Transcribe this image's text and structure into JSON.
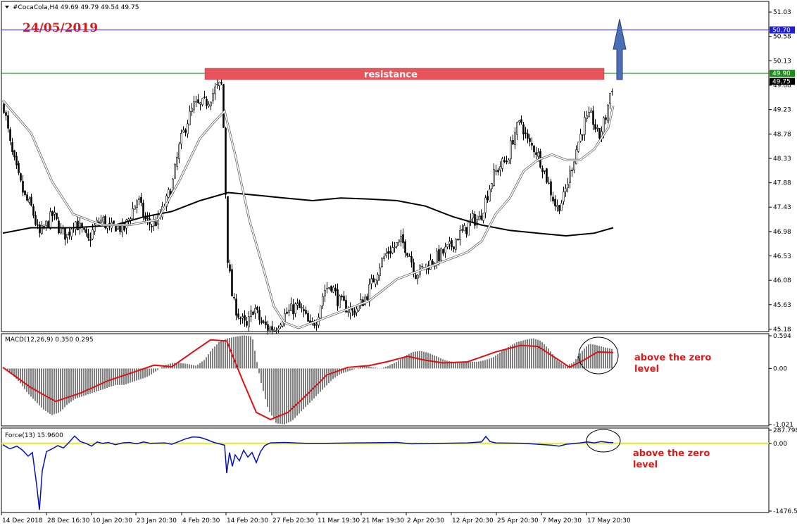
{
  "header": {
    "symbol_info": "#CocaCola,H4  49.69 49.79 49.54 49.75",
    "date_annotation": "24/05/2019",
    "resistance_label": "resistance"
  },
  "colors": {
    "candle": "#000000",
    "sma_fast": "#ffffff",
    "sma_slow": "#000000",
    "resistance_fill": "#e8545a",
    "blue_level": "#2020d0",
    "green_level": "#1a8c1a",
    "macd_signal": "#e01010",
    "force_line": "#0010c8",
    "force_zero": "#e8e820",
    "annotation": "#e01818",
    "arrow": "#4a6fb5"
  },
  "chart_data": [
    {
      "type": "candlestick",
      "title": "#CocaCola,H4",
      "ohlc_last": {
        "open": 49.69,
        "high": 49.79,
        "low": 49.54,
        "close": 49.75
      },
      "y_ticks": [
        51.03,
        50.58,
        50.13,
        49.68,
        49.23,
        48.78,
        48.33,
        47.88,
        47.43,
        46.98,
        46.53,
        46.08,
        45.63,
        45.18
      ],
      "ylim": [
        45.16,
        51.2
      ],
      "price_labels": [
        {
          "label": "50.70",
          "value": 50.7,
          "color": "#2020d0"
        },
        {
          "label": "49.90",
          "value": 49.9,
          "color": "#1a8c1a"
        },
        {
          "label": "49.75",
          "value": 49.75,
          "color": "#000000"
        }
      ],
      "x_ticks": [
        "14 Dec 2018",
        "28 Dec 16:30",
        "10 Jan 20:30",
        "23 Jan 20:30",
        "4 Feb 20:30",
        "14 Feb 20:30",
        "27 Feb 20:30",
        "11 Mar 19:30",
        "21 Mar 19:30",
        "2 Apr 20:30",
        "12 Apr 20:30",
        "25 Apr 20:30",
        "7 May 20:30",
        "17 May 20:30"
      ],
      "close_path": [
        [
          0,
          49.3
        ],
        [
          10,
          48.5
        ],
        [
          20,
          48.0
        ],
        [
          30,
          47.6
        ],
        [
          40,
          47.4
        ],
        [
          50,
          46.9
        ],
        [
          60,
          47.1
        ],
        [
          70,
          47.3
        ],
        [
          80,
          47.0
        ],
        [
          90,
          46.9
        ],
        [
          100,
          47.2
        ],
        [
          110,
          47.0
        ],
        [
          120,
          46.8
        ],
        [
          130,
          47.1
        ],
        [
          140,
          47.2
        ],
        [
          150,
          47.0
        ],
        [
          160,
          47.1
        ],
        [
          170,
          47.0
        ],
        [
          180,
          47.3
        ],
        [
          190,
          47.6
        ],
        [
          200,
          47.2
        ],
        [
          210,
          47.1
        ],
        [
          220,
          47.2
        ],
        [
          230,
          47.5
        ],
        [
          240,
          47.9
        ],
        [
          250,
          48.6
        ],
        [
          260,
          49.0
        ],
        [
          270,
          49.3
        ],
        [
          280,
          49.3
        ],
        [
          290,
          49.4
        ],
        [
          300,
          49.6
        ],
        [
          310,
          49.7
        ],
        [
          318,
          46.5
        ],
        [
          325,
          45.7
        ],
        [
          335,
          45.4
        ],
        [
          345,
          45.2
        ],
        [
          355,
          45.6
        ],
        [
          365,
          45.3
        ],
        [
          375,
          45.2
        ],
        [
          385,
          45.2
        ],
        [
          395,
          45.4
        ],
        [
          405,
          45.5
        ],
        [
          415,
          45.6
        ],
        [
          425,
          45.5
        ],
        [
          435,
          45.2
        ],
        [
          445,
          45.4
        ],
        [
          455,
          45.9
        ],
        [
          465,
          46.0
        ],
        [
          475,
          45.7
        ],
        [
          485,
          45.6
        ],
        [
          495,
          45.5
        ],
        [
          505,
          45.6
        ],
        [
          515,
          45.8
        ],
        [
          525,
          46.1
        ],
        [
          535,
          46.4
        ],
        [
          545,
          46.6
        ],
        [
          555,
          46.7
        ],
        [
          565,
          46.8
        ],
        [
          575,
          46.6
        ],
        [
          585,
          46.2
        ],
        [
          595,
          46.3
        ],
        [
          605,
          46.4
        ],
        [
          615,
          46.5
        ],
        [
          625,
          46.6
        ],
        [
          635,
          46.7
        ],
        [
          645,
          46.9
        ],
        [
          655,
          47.0
        ],
        [
          665,
          47.2
        ],
        [
          675,
          47.2
        ],
        [
          685,
          47.6
        ],
        [
          695,
          48.0
        ],
        [
          705,
          48.2
        ],
        [
          715,
          48.3
        ],
        [
          725,
          48.8
        ],
        [
          735,
          49.0
        ],
        [
          745,
          48.6
        ],
        [
          755,
          48.5
        ],
        [
          765,
          48.2
        ],
        [
          775,
          47.8
        ],
        [
          785,
          47.4
        ],
        [
          795,
          47.6
        ],
        [
          805,
          48.1
        ],
        [
          815,
          48.6
        ],
        [
          825,
          49.0
        ],
        [
          835,
          49.1
        ],
        [
          845,
          48.7
        ],
        [
          855,
          49.1
        ],
        [
          862,
          49.6
        ],
        [
          867,
          49.75
        ]
      ],
      "sma_fast_path": [
        [
          0,
          49.4
        ],
        [
          40,
          48.8
        ],
        [
          70,
          47.9
        ],
        [
          100,
          47.3
        ],
        [
          140,
          47.1
        ],
        [
          180,
          47.1
        ],
        [
          220,
          47.2
        ],
        [
          250,
          47.9
        ],
        [
          280,
          48.7
        ],
        [
          300,
          49.0
        ],
        [
          315,
          49.2
        ],
        [
          330,
          48.4
        ],
        [
          350,
          47.2
        ],
        [
          370,
          46.3
        ],
        [
          385,
          45.6
        ],
        [
          400,
          45.3
        ],
        [
          420,
          45.2
        ],
        [
          440,
          45.3
        ],
        [
          460,
          45.4
        ],
        [
          480,
          45.5
        ],
        [
          500,
          45.6
        ],
        [
          520,
          45.7
        ],
        [
          540,
          45.9
        ],
        [
          560,
          46.1
        ],
        [
          580,
          46.2
        ],
        [
          600,
          46.3
        ],
        [
          620,
          46.4
        ],
        [
          640,
          46.5
        ],
        [
          660,
          46.6
        ],
        [
          680,
          46.8
        ],
        [
          700,
          47.3
        ],
        [
          720,
          47.6
        ],
        [
          740,
          48.1
        ],
        [
          760,
          48.3
        ],
        [
          780,
          48.4
        ],
        [
          800,
          48.3
        ],
        [
          820,
          48.3
        ],
        [
          840,
          48.5
        ],
        [
          860,
          48.9
        ],
        [
          867,
          49.3
        ]
      ],
      "sma_slow_path": [
        [
          0,
          46.95
        ],
        [
          40,
          47.05
        ],
        [
          100,
          47.05
        ],
        [
          160,
          47.1
        ],
        [
          200,
          47.25
        ],
        [
          240,
          47.35
        ],
        [
          280,
          47.55
        ],
        [
          320,
          47.7
        ],
        [
          360,
          47.65
        ],
        [
          400,
          47.6
        ],
        [
          440,
          47.55
        ],
        [
          480,
          47.6
        ],
        [
          520,
          47.58
        ],
        [
          560,
          47.55
        ],
        [
          600,
          47.45
        ],
        [
          640,
          47.25
        ],
        [
          680,
          47.1
        ],
        [
          720,
          47.0
        ],
        [
          760,
          46.95
        ],
        [
          800,
          46.9
        ],
        [
          840,
          46.95
        ],
        [
          867,
          47.05
        ]
      ]
    },
    {
      "type": "bar",
      "title": "MACD(12,26,9) 0.350 0.295",
      "y_ticks": [
        0.594,
        0.0,
        -1.021
      ],
      "ylim": [
        -1.021,
        0.594
      ],
      "histogram": [
        0.02,
        -0.1,
        -0.25,
        -0.45,
        -0.6,
        -0.75,
        -0.85,
        -0.8,
        -0.65,
        -0.55,
        -0.5,
        -0.45,
        -0.4,
        -0.35,
        -0.3,
        -0.3,
        -0.25,
        -0.2,
        -0.15,
        -0.05,
        0.05,
        0.1,
        0.1,
        0.08,
        0.05,
        0.15,
        0.35,
        0.5,
        0.55,
        0.58,
        0.6,
        0.58,
        -0.2,
        -0.75,
        -1.0,
        -1.02,
        -0.95,
        -0.8,
        -0.65,
        -0.5,
        -0.35,
        -0.2,
        -0.1,
        -0.05,
        0.0,
        0.05,
        0.02,
        0.0,
        0.05,
        0.12,
        0.22,
        0.3,
        0.32,
        0.28,
        0.22,
        0.15,
        0.12,
        0.12,
        0.12,
        0.12,
        0.15,
        0.2,
        0.3,
        0.4,
        0.48,
        0.52,
        0.55,
        0.5,
        0.35,
        0.15,
        0.05,
        0.1,
        0.3,
        0.45,
        0.42,
        0.38,
        0.35
      ],
      "signal_path": [
        [
          0,
          0.02
        ],
        [
          40,
          -0.35
        ],
        [
          75,
          -0.6
        ],
        [
          110,
          -0.45
        ],
        [
          150,
          -0.22
        ],
        [
          190,
          -0.05
        ],
        [
          215,
          0.06
        ],
        [
          240,
          0.03
        ],
        [
          270,
          0.3
        ],
        [
          295,
          0.52
        ],
        [
          318,
          0.5
        ],
        [
          340,
          -0.2
        ],
        [
          360,
          -0.8
        ],
        [
          380,
          -0.93
        ],
        [
          405,
          -0.8
        ],
        [
          430,
          -0.5
        ],
        [
          460,
          -0.12
        ],
        [
          490,
          0.02
        ],
        [
          520,
          0.05
        ],
        [
          545,
          0.12
        ],
        [
          575,
          0.22
        ],
        [
          600,
          0.15
        ],
        [
          625,
          0.1
        ],
        [
          660,
          0.12
        ],
        [
          700,
          0.3
        ],
        [
          735,
          0.42
        ],
        [
          760,
          0.4
        ],
        [
          790,
          0.15
        ],
        [
          805,
          0.02
        ],
        [
          825,
          0.15
        ],
        [
          845,
          0.3
        ],
        [
          867,
          0.29
        ]
      ]
    },
    {
      "type": "line",
      "title": "Force(13) 15.9600",
      "y_ticks": [
        287.7989,
        0.0,
        -1476.51
      ],
      "ylim": [
        -1476.51,
        287.7989
      ],
      "force_path": [
        [
          0,
          -30
        ],
        [
          10,
          -120
        ],
        [
          20,
          -60
        ],
        [
          28,
          -150
        ],
        [
          36,
          -280
        ],
        [
          42,
          -200
        ],
        [
          48,
          -900
        ],
        [
          52,
          -1450
        ],
        [
          56,
          -600
        ],
        [
          62,
          -180
        ],
        [
          70,
          -120
        ],
        [
          78,
          -50
        ],
        [
          86,
          -100
        ],
        [
          94,
          20
        ],
        [
          102,
          160
        ],
        [
          110,
          40
        ],
        [
          118,
          0
        ],
        [
          126,
          -60
        ],
        [
          134,
          30
        ],
        [
          142,
          0
        ],
        [
          150,
          20
        ],
        [
          160,
          -30
        ],
        [
          170,
          10
        ],
        [
          180,
          20
        ],
        [
          190,
          -10
        ],
        [
          200,
          30
        ],
        [
          210,
          0
        ],
        [
          230,
          10
        ],
        [
          240,
          -20
        ],
        [
          250,
          40
        ],
        [
          260,
          100
        ],
        [
          270,
          140
        ],
        [
          280,
          130
        ],
        [
          290,
          80
        ],
        [
          300,
          20
        ],
        [
          315,
          -40
        ],
        [
          318,
          -650
        ],
        [
          322,
          -200
        ],
        [
          326,
          -500
        ],
        [
          330,
          -250
        ],
        [
          336,
          -380
        ],
        [
          342,
          -150
        ],
        [
          348,
          -300
        ],
        [
          354,
          -200
        ],
        [
          360,
          -420
        ],
        [
          366,
          -180
        ],
        [
          372,
          -50
        ],
        [
          380,
          10
        ],
        [
          400,
          20
        ],
        [
          430,
          0
        ],
        [
          460,
          0
        ],
        [
          500,
          10
        ],
        [
          540,
          15
        ],
        [
          560,
          20
        ],
        [
          580,
          -10
        ],
        [
          620,
          0
        ],
        [
          660,
          10
        ],
        [
          680,
          30
        ],
        [
          686,
          150
        ],
        [
          692,
          40
        ],
        [
          700,
          10
        ],
        [
          740,
          0
        ],
        [
          760,
          -20
        ],
        [
          780,
          -40
        ],
        [
          790,
          -60
        ],
        [
          800,
          -20
        ],
        [
          820,
          10
        ],
        [
          830,
          30
        ],
        [
          840,
          10
        ],
        [
          850,
          40
        ],
        [
          860,
          20
        ],
        [
          867,
          16
        ]
      ]
    }
  ],
  "annotations": {
    "macd_note": [
      "above the zero",
      "level"
    ],
    "force_note": [
      "above the zero",
      "level"
    ]
  }
}
